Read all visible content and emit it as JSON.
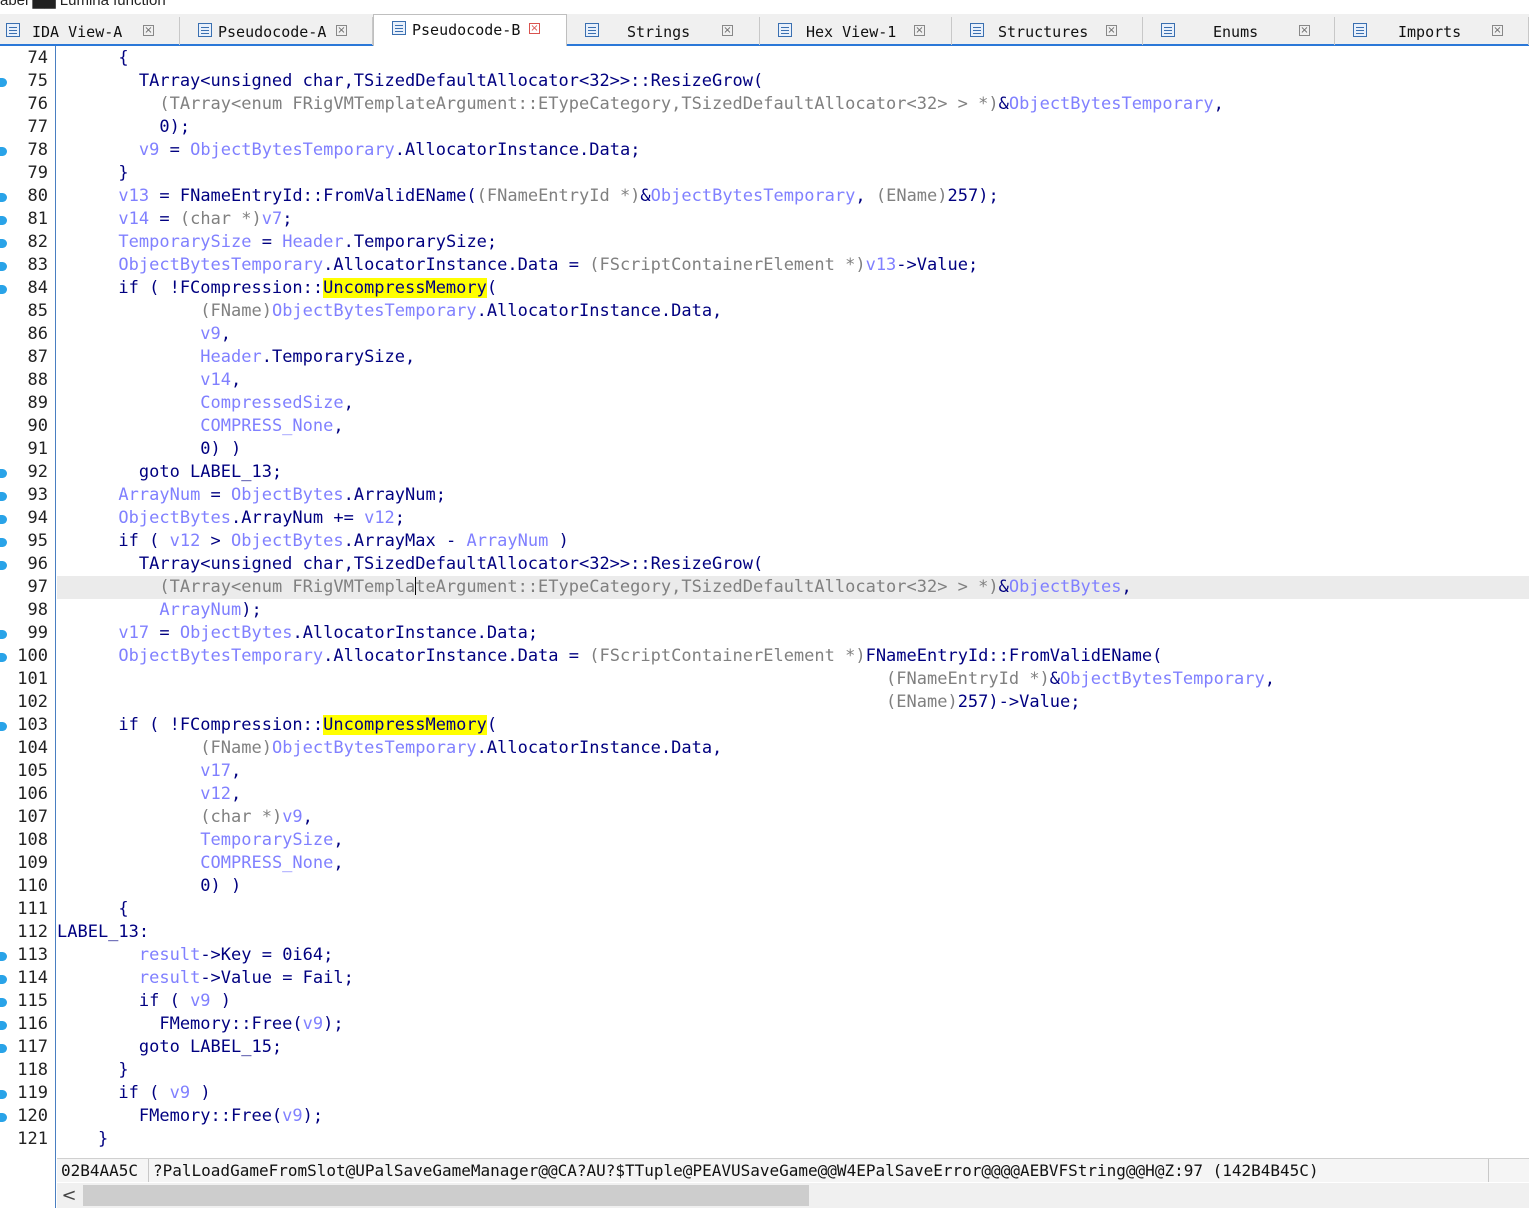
{
  "window": {
    "top_strip_text": "abel  ▇▇ Lumina function"
  },
  "tabs": [
    {
      "label": "IDA View-A",
      "icon": "ida-view-icon",
      "active": false
    },
    {
      "label": "Pseudocode-A",
      "icon": "pseudocode-icon",
      "active": false
    },
    {
      "label": "Pseudocode-B",
      "icon": "pseudocode-icon",
      "active": true
    },
    {
      "label": "Strings",
      "icon": "strings-icon",
      "active": false
    },
    {
      "label": "Hex View-1",
      "icon": "hex-view-icon",
      "active": false
    },
    {
      "label": "Structures",
      "icon": "structures-icon",
      "active": false
    },
    {
      "label": "Enums",
      "icon": "enums-icon",
      "active": false
    },
    {
      "label": "Imports",
      "icon": "imports-icon",
      "active": false
    }
  ],
  "code": {
    "current_line": 97,
    "highlight_word": "UncompressMemory",
    "breakpoint_lines": [
      75,
      78,
      80,
      81,
      82,
      83,
      84,
      92,
      93,
      94,
      95,
      96,
      99,
      100,
      103,
      113,
      114,
      115,
      116,
      117,
      119,
      120
    ],
    "lines": [
      {
        "n": "74",
        "text": "      {"
      },
      {
        "n": "75",
        "text": "        TArray<unsigned char,TSizedDefaultAllocator<32>>::ResizeGrow("
      },
      {
        "n": "76",
        "text": "          (TArray<enum FRigVMTemplateArgument::ETypeCategory,TSizedDefaultAllocator<32> > *)&ObjectBytesTemporary,"
      },
      {
        "n": "77",
        "text": "          0);"
      },
      {
        "n": "78",
        "text": "        v9 = ObjectBytesTemporary.AllocatorInstance.Data;"
      },
      {
        "n": "79",
        "text": "      }"
      },
      {
        "n": "80",
        "text": "      v13 = FNameEntryId::FromValidEName((FNameEntryId *)&ObjectBytesTemporary, (EName)257);"
      },
      {
        "n": "81",
        "text": "      v14 = (char *)v7;"
      },
      {
        "n": "82",
        "text": "      TemporarySize = Header.TemporarySize;"
      },
      {
        "n": "83",
        "text": "      ObjectBytesTemporary.AllocatorInstance.Data = (FScriptContainerElement *)v13->Value;"
      },
      {
        "n": "84",
        "text": "      if ( !FCompression::UncompressMemory("
      },
      {
        "n": "85",
        "text": "              (FName)ObjectBytesTemporary.AllocatorInstance.Data,"
      },
      {
        "n": "86",
        "text": "              v9,"
      },
      {
        "n": "87",
        "text": "              Header.TemporarySize,"
      },
      {
        "n": "88",
        "text": "              v14,"
      },
      {
        "n": "89",
        "text": "              CompressedSize,"
      },
      {
        "n": "90",
        "text": "              COMPRESS_None,"
      },
      {
        "n": "91",
        "text": "              0) )"
      },
      {
        "n": "92",
        "text": "        goto LABEL_13;"
      },
      {
        "n": "93",
        "text": "      ArrayNum = ObjectBytes.ArrayNum;"
      },
      {
        "n": "94",
        "text": "      ObjectBytes.ArrayNum += v12;"
      },
      {
        "n": "95",
        "text": "      if ( v12 > ObjectBytes.ArrayMax - ArrayNum )"
      },
      {
        "n": "96",
        "text": "        TArray<unsigned char,TSizedDefaultAllocator<32>>::ResizeGrow("
      },
      {
        "n": "97",
        "text": "          (TArray<enum FRigVMTemplateArgument::ETypeCategory,TSizedDefaultAllocator<32> > *)&ObjectBytes,"
      },
      {
        "n": "98",
        "text": "          ArrayNum);"
      },
      {
        "n": "99",
        "text": "      v17 = ObjectBytes.AllocatorInstance.Data;"
      },
      {
        "n": "100",
        "text": "      ObjectBytesTemporary.AllocatorInstance.Data = (FScriptContainerElement *)FNameEntryId::FromValidEName("
      },
      {
        "n": "101",
        "text": "                                                                                 (FNameEntryId *)&ObjectBytesTemporary,"
      },
      {
        "n": "102",
        "text": "                                                                                 (EName)257)->Value;"
      },
      {
        "n": "103",
        "text": "      if ( !FCompression::UncompressMemory("
      },
      {
        "n": "104",
        "text": "              (FName)ObjectBytesTemporary.AllocatorInstance.Data,"
      },
      {
        "n": "105",
        "text": "              v17,"
      },
      {
        "n": "106",
        "text": "              v12,"
      },
      {
        "n": "107",
        "text": "              (char *)v9,"
      },
      {
        "n": "108",
        "text": "              TemporarySize,"
      },
      {
        "n": "109",
        "text": "              COMPRESS_None,"
      },
      {
        "n": "110",
        "text": "              0) )"
      },
      {
        "n": "111",
        "text": "      {"
      },
      {
        "n": "112",
        "text": "LABEL_13:"
      },
      {
        "n": "113",
        "text": "        result->Key = 0i64;"
      },
      {
        "n": "114",
        "text": "        result->Value = Fail;"
      },
      {
        "n": "115",
        "text": "        if ( v9 )"
      },
      {
        "n": "116",
        "text": "          FMemory::Free(v9);"
      },
      {
        "n": "117",
        "text": "        goto LABEL_15;"
      },
      {
        "n": "118",
        "text": "      }"
      },
      {
        "n": "119",
        "text": "      if ( v9 )"
      },
      {
        "n": "120",
        "text": "        FMemory::Free(v9);"
      },
      {
        "n": "121",
        "text": "    }"
      }
    ]
  },
  "status_bar": {
    "address": "02B4AA5C",
    "location": "?PalLoadGameFromSlot@UPalSaveGameManager@@CA?AU?$TTuple@PEAVUSaveGame@@W4EPalSaveError@@@@AEBVFString@@H@Z:97 (142B4B45C)"
  },
  "scrollbar": {
    "left_arrow": "<"
  },
  "colors": {
    "accent": "#2b78d8",
    "breakpoint": "#29a3e8",
    "highlight": "#ffff00",
    "code_default": "#000080",
    "code_variable": "#8080ff",
    "code_cast": "#808080"
  }
}
